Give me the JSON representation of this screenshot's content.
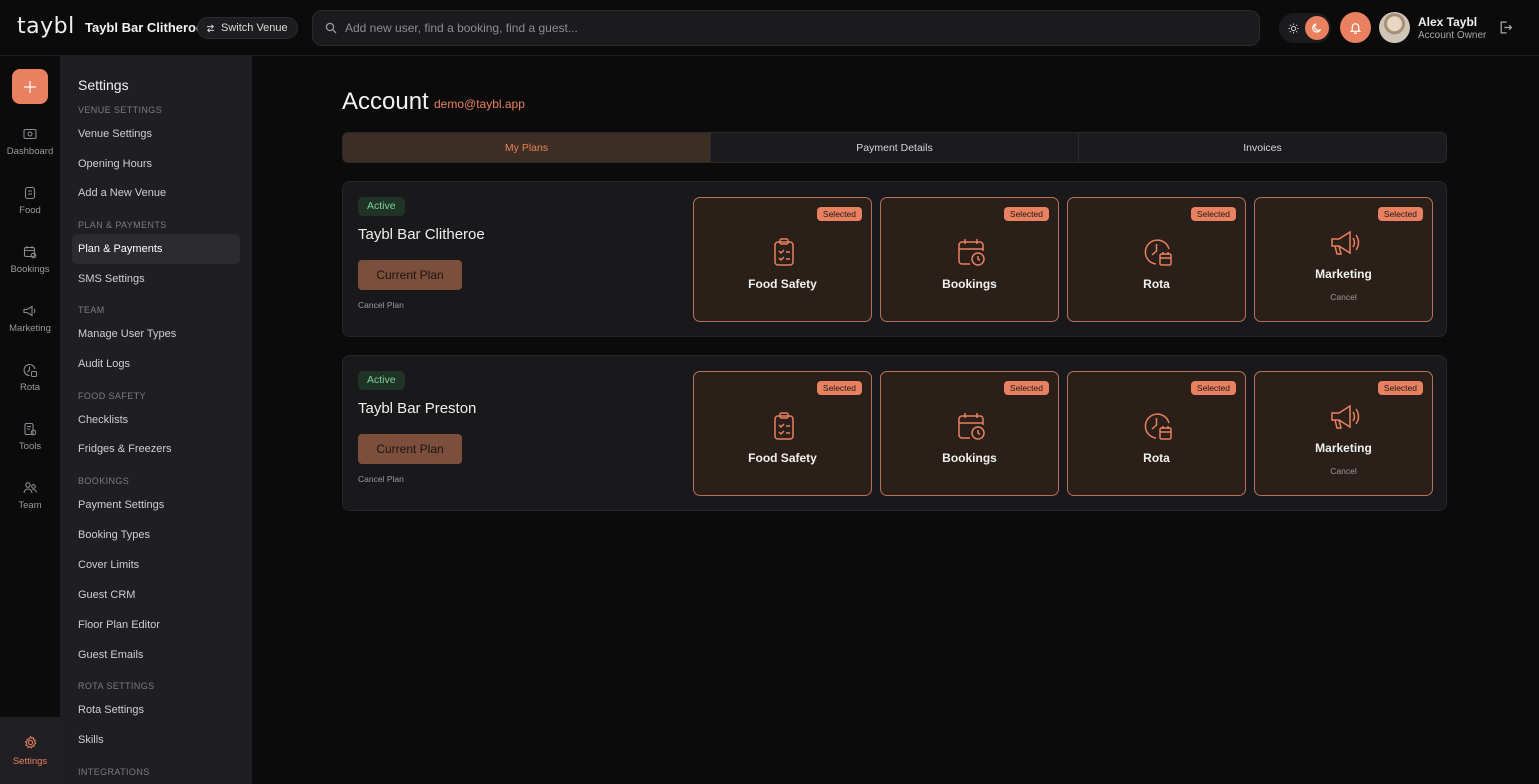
{
  "brand": {
    "logo_text": "taybl",
    "accent": "#e9805f"
  },
  "header": {
    "venue_name": "Taybl Bar Clitheroe",
    "switch_venue_label": "Switch Venue",
    "search_placeholder": "Add new user, find a booking, find a guest...",
    "user_name": "Alex Taybl",
    "user_role": "Account Owner"
  },
  "rail": {
    "items": [
      {
        "label": "Dashboard",
        "icon": "dashboard-icon"
      },
      {
        "label": "Food",
        "icon": "food-icon"
      },
      {
        "label": "Bookings",
        "icon": "bookings-icon"
      },
      {
        "label": "Marketing",
        "icon": "marketing-icon"
      },
      {
        "label": "Rota",
        "icon": "rota-icon"
      },
      {
        "label": "Tools",
        "icon": "tools-icon"
      },
      {
        "label": "Team",
        "icon": "team-icon"
      }
    ],
    "settings_label": "Settings"
  },
  "settings_nav": {
    "title": "Settings",
    "sections": {
      "venue": "VENUE SETTINGS",
      "plan": "PLAN & PAYMENTS",
      "team": "TEAM",
      "food": "FOOD SAFETY",
      "bookings": "BOOKINGS",
      "rota": "ROTA SETTINGS",
      "integrations": "INTEGRATIONS"
    },
    "links": {
      "venue_settings": "Venue Settings",
      "opening_hours": "Opening Hours",
      "add_venue": "Add a New Venue",
      "plan_payments": "Plan & Payments",
      "sms_settings": "SMS Settings",
      "manage_user_types": "Manage User Types",
      "audit_logs": "Audit Logs",
      "checklists": "Checklists",
      "fridges": "Fridges & Freezers",
      "payment_settings": "Payment Settings",
      "booking_types": "Booking Types",
      "cover_limits": "Cover Limits",
      "guest_crm": "Guest CRM",
      "floor_plan": "Floor Plan Editor",
      "guest_emails": "Guest Emails",
      "rota_settings": "Rota Settings",
      "skills": "Skills"
    }
  },
  "account": {
    "title": "Account",
    "email": "demo@taybl.app",
    "tabs": [
      "My Plans",
      "Payment Details",
      "Invoices"
    ],
    "active_tab": "My Plans"
  },
  "plans": [
    {
      "status": "Active",
      "venue": "Taybl Bar Clitheroe",
      "current_plan_label": "Current Plan",
      "cancel_plan_label": "Cancel Plan",
      "features": [
        {
          "name": "Food Safety",
          "badge": "Selected",
          "icon": "clipboard-check-icon"
        },
        {
          "name": "Bookings",
          "badge": "Selected",
          "icon": "calendar-clock-icon"
        },
        {
          "name": "Rota",
          "badge": "Selected",
          "icon": "clock-calendar-icon"
        },
        {
          "name": "Marketing",
          "badge": "Selected",
          "icon": "megaphone-icon",
          "cancel": "Cancel"
        }
      ]
    },
    {
      "status": "Active",
      "venue": "Taybl Bar Preston",
      "current_plan_label": "Current Plan",
      "cancel_plan_label": "Cancel Plan",
      "features": [
        {
          "name": "Food Safety",
          "badge": "Selected",
          "icon": "clipboard-check-icon"
        },
        {
          "name": "Bookings",
          "badge": "Selected",
          "icon": "calendar-clock-icon"
        },
        {
          "name": "Rota",
          "badge": "Selected",
          "icon": "clock-calendar-icon"
        },
        {
          "name": "Marketing",
          "badge": "Selected",
          "icon": "megaphone-icon",
          "cancel": "Cancel"
        }
      ]
    }
  ]
}
